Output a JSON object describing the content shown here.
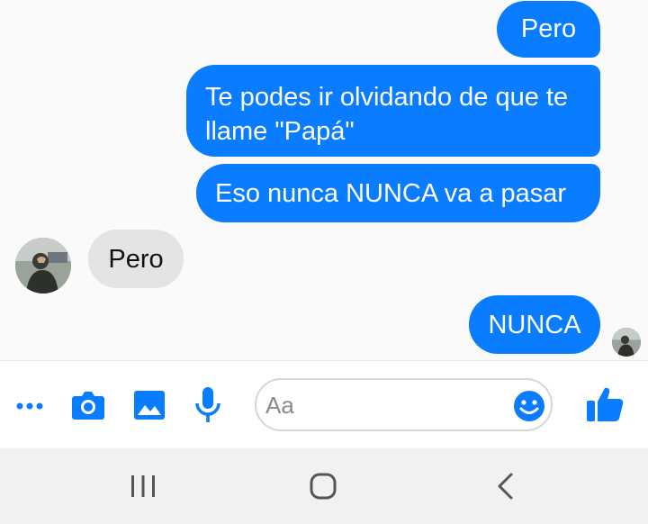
{
  "messages": [
    {
      "direction": "out",
      "text": "Pero"
    },
    {
      "direction": "out",
      "text": "Te podes ir olvidando de que te llame \"Papá\""
    },
    {
      "direction": "out",
      "text": "Eso nunca NUNCA va a pasar"
    },
    {
      "direction": "in",
      "text": "Pero"
    },
    {
      "direction": "out",
      "text": "NUNCA"
    }
  ],
  "composer": {
    "placeholder": "Aa",
    "icons": [
      "more-icon",
      "camera-icon",
      "image-icon",
      "microphone-icon",
      "emoji-icon",
      "thumbs-up-icon"
    ]
  },
  "colors": {
    "accent": "#0a7cff",
    "outgoing_bubble": "#0a7cff",
    "incoming_bubble": "#e4e4e4",
    "navbar": "#f1f1f1"
  },
  "navigation": {
    "icons": [
      "recent-apps-icon",
      "home-icon",
      "back-icon"
    ]
  }
}
